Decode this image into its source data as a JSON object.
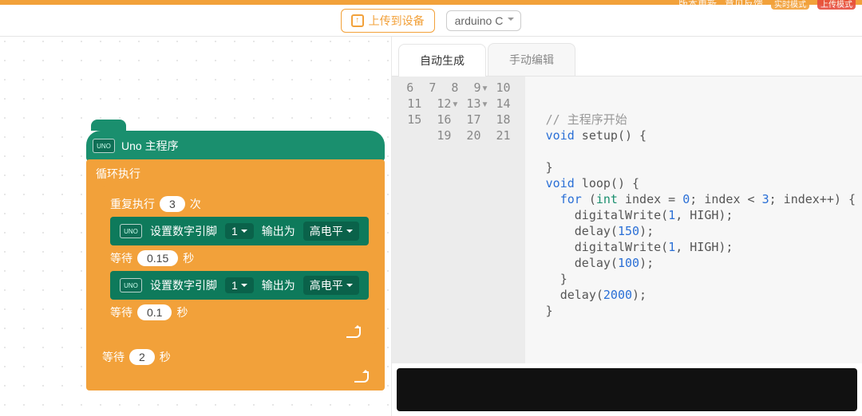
{
  "header": {
    "links": [
      "版本更新",
      "意见反馈"
    ],
    "badges": [
      "实时模式",
      "上传模式"
    ]
  },
  "toolbar": {
    "upload_label": "上传到设备",
    "language_selected": "arduino C"
  },
  "tabs": {
    "auto": "自动生成",
    "manual": "手动编辑"
  },
  "blocks": {
    "hat_label": "Uno 主程序",
    "uno_icon": "UNO",
    "loop_label": "循环执行",
    "repeat_label_prefix": "重复执行",
    "repeat_count": "3",
    "repeat_label_suffix": "次",
    "pinset1": {
      "label": "设置数字引脚",
      "pin": "1",
      "out_label": "输出为",
      "level": "高电平"
    },
    "wait1_prefix": "等待",
    "wait1_value": "0.15",
    "wait1_suffix": "秒",
    "pinset2": {
      "label": "设置数字引脚",
      "pin": "1",
      "out_label": "输出为",
      "level": "高电平"
    },
    "wait2_prefix": "等待",
    "wait2_value": "0.1",
    "wait2_suffix": "秒",
    "wait3_prefix": "等待",
    "wait3_value": "2",
    "wait3_suffix": "秒"
  },
  "code": {
    "line_numbers": [
      "6",
      "7",
      "8",
      "9",
      "10",
      "11",
      "12",
      "13",
      "14",
      "15",
      "16",
      "17",
      "18",
      "19",
      "20",
      "21"
    ],
    "fold_lines": [
      9,
      12,
      13
    ],
    "comment_8": "// 主程序开始",
    "kw_void": "void",
    "fn_setup": "setup",
    "fn_loop": "loop",
    "kw_for": "for",
    "kw_int": "int",
    "id_index": "index",
    "val_0": "0",
    "val_3": "3",
    "fn_digitalWrite": "digitalWrite",
    "arg_pin": "1",
    "arg_level": "HIGH",
    "fn_delay": "delay",
    "val_150": "150",
    "val_100": "100",
    "val_2000": "2000"
  }
}
